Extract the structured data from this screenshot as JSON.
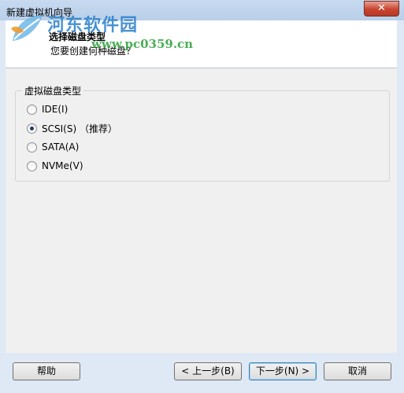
{
  "window": {
    "title": "新建虚拟机向导",
    "close_label": "✕"
  },
  "watermark": {
    "brand": "河东软件园",
    "url": "www.pc0359.cn",
    "logo": "leaf-logo"
  },
  "header": {
    "title": "选择磁盘类型",
    "subtitle": "您要创建何种磁盘？"
  },
  "group": {
    "legend": "虚拟磁盘类型",
    "options": [
      {
        "label": "IDE(I)",
        "selected": false
      },
      {
        "label": "SCSI(S) （推荐）",
        "selected": true
      },
      {
        "label": "SATA(A)",
        "selected": false
      },
      {
        "label": "NVMe(V)",
        "selected": false
      }
    ]
  },
  "footer": {
    "help": "帮助",
    "back": "< 上一步(B)",
    "next": "下一步(N) >",
    "cancel": "取消"
  }
}
